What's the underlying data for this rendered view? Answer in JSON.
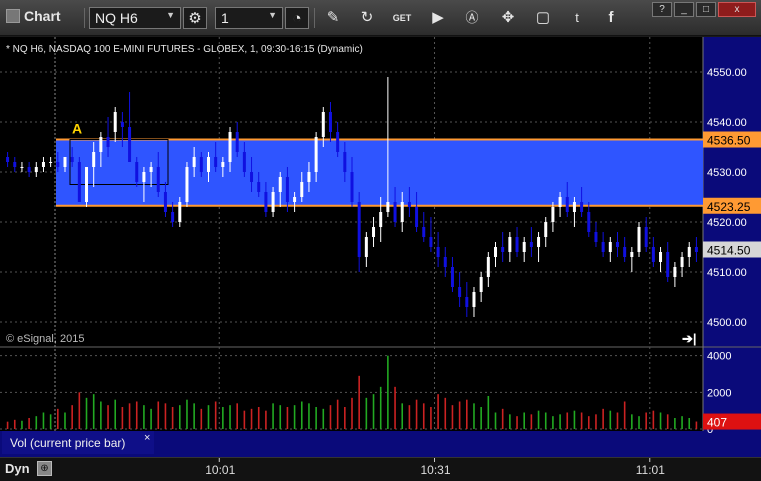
{
  "toolbar": {
    "title": "Chart",
    "symbol": "NQ H6",
    "interval": "1",
    "icons": [
      "link-icon",
      "clock-icon",
      "pencil-icon",
      "refresh-icon",
      "get-icon",
      "play-icon",
      "a-circle-icon",
      "tools-icon",
      "chat-icon",
      "twitter-icon",
      "facebook-icon"
    ],
    "window_buttons": [
      "?",
      "_",
      "□",
      "x"
    ]
  },
  "chart": {
    "header": "* NQ H6, NASDAQ 100 E-MINI FUTURES - GLOBEX, 1, 09:30-16:15 (Dynamic)",
    "watermark": "© eSignal, 2015",
    "annotation_label": "A",
    "range_high_label": "4536.50",
    "range_low_label": "4523.25",
    "current_price_label": "4514.50",
    "price_ticks": [
      "4550.00",
      "4540.00",
      "4530.00",
      "4520.00",
      "4510.00",
      "4500.00"
    ],
    "volume_ticks": [
      "4000",
      "2000",
      "0"
    ],
    "current_volume_label": "407",
    "time_ticks": [
      "10:01",
      "10:31",
      "11:01"
    ],
    "volume_panel_label": "Vol (current price bar)",
    "volume_close": "×",
    "colors": {
      "background": "#000000",
      "axis_bg": "#0a0a7a",
      "band_fill": "#2f55ff",
      "band_line": "#ff9a33",
      "up_bar": "#ffffff",
      "down_bar": "#1010e0",
      "vol_up": "#22aa22",
      "vol_down": "#cc2222",
      "vol_last": "#dd1111"
    }
  },
  "chart_data": {
    "type": "bar",
    "title": "",
    "price": {
      "ylim": [
        4496,
        4555
      ],
      "bars": [
        [
          4533,
          4534,
          4531,
          4532
        ],
        [
          4532,
          4533,
          4530,
          4531
        ],
        [
          4531,
          4532,
          4530,
          4531
        ],
        [
          4531,
          4532,
          4529,
          4530
        ],
        [
          4530,
          4532,
          4529,
          4531
        ],
        [
          4531,
          4533,
          4530,
          4532
        ],
        [
          4532,
          4533,
          4531,
          4532
        ],
        [
          4532,
          4534,
          4530,
          4531
        ],
        [
          4531,
          4533,
          4530,
          4533
        ],
        [
          4533,
          4535,
          4531,
          4532
        ],
        [
          4532,
          4533,
          4524,
          4524
        ],
        [
          4524,
          4531,
          4523,
          4531
        ],
        [
          4531,
          4536,
          4527,
          4534
        ],
        [
          4534,
          4538,
          4531,
          4537
        ],
        [
          4537,
          4541,
          4533,
          4535
        ],
        [
          4538,
          4543,
          4536,
          4542
        ],
        [
          4540,
          4542,
          4535,
          4539
        ],
        [
          4539,
          4546,
          4532,
          4532
        ],
        [
          4532,
          4533,
          4527,
          4528
        ],
        [
          4528,
          4531,
          4524,
          4530
        ],
        [
          4530,
          4532,
          4527,
          4531
        ],
        [
          4531,
          4534,
          4525,
          4526
        ],
        [
          4526,
          4528,
          4521,
          4522
        ],
        [
          4522,
          4524,
          4519,
          4520
        ],
        [
          4520,
          4525,
          4519,
          4524
        ],
        [
          4524,
          4532,
          4523,
          4531
        ],
        [
          4531,
          4535,
          4529,
          4533
        ],
        [
          4533,
          4534,
          4529,
          4530
        ],
        [
          4530,
          4534,
          4528,
          4533
        ],
        [
          4533,
          4536,
          4530,
          4531
        ],
        [
          4531,
          4533,
          4529,
          4532
        ],
        [
          4532,
          4539,
          4530,
          4538
        ],
        [
          4538,
          4540,
          4533,
          4534
        ],
        [
          4534,
          4536,
          4529,
          4530
        ],
        [
          4530,
          4533,
          4526,
          4528
        ],
        [
          4528,
          4530,
          4525,
          4526
        ],
        [
          4526,
          4528,
          4521,
          4522
        ],
        [
          4522,
          4527,
          4521,
          4526
        ],
        [
          4526,
          4530,
          4523,
          4529
        ],
        [
          4529,
          4531,
          4522,
          4524
        ],
        [
          4524,
          4526,
          4522,
          4525
        ],
        [
          4525,
          4530,
          4524,
          4528
        ],
        [
          4528,
          4532,
          4526,
          4530
        ],
        [
          4530,
          4538,
          4528,
          4537
        ],
        [
          4537,
          4543,
          4535,
          4542
        ],
        [
          4542,
          4544,
          4536,
          4538
        ],
        [
          4538,
          4540,
          4533,
          4534
        ],
        [
          4534,
          4536,
          4528,
          4530
        ],
        [
          4530,
          4533,
          4523,
          4524
        ],
        [
          4524,
          4526,
          4510,
          4513
        ],
        [
          4513,
          4518,
          4511,
          4517
        ],
        [
          4517,
          4521,
          4515,
          4519
        ],
        [
          4519,
          4525,
          4516,
          4522
        ],
        [
          4522,
          4549,
          4521,
          4524
        ],
        [
          4524,
          4527,
          4519,
          4520
        ],
        [
          4520,
          4526,
          4518,
          4524
        ],
        [
          4524,
          4527,
          4521,
          4523
        ],
        [
          4523,
          4526,
          4518,
          4519
        ],
        [
          4519,
          4522,
          4516,
          4517
        ],
        [
          4517,
          4521,
          4514,
          4515
        ],
        [
          4515,
          4518,
          4511,
          4513
        ],
        [
          4513,
          4515,
          4509,
          4511
        ],
        [
          4511,
          4513,
          4506,
          4507
        ],
        [
          4507,
          4510,
          4503,
          4505
        ],
        [
          4505,
          4508,
          4501,
          4503
        ],
        [
          4503,
          4507,
          4501,
          4506
        ],
        [
          4506,
          4510,
          4504,
          4509
        ],
        [
          4509,
          4514,
          4507,
          4513
        ],
        [
          4513,
          4516,
          4511,
          4515
        ],
        [
          4515,
          4518,
          4512,
          4514
        ],
        [
          4514,
          4518,
          4512,
          4517
        ],
        [
          4517,
          4519,
          4513,
          4514
        ],
        [
          4514,
          4517,
          4512,
          4516
        ],
        [
          4516,
          4519,
          4513,
          4515
        ],
        [
          4515,
          4518,
          4512,
          4517
        ],
        [
          4517,
          4521,
          4515,
          4520
        ],
        [
          4520,
          4524,
          4518,
          4523
        ],
        [
          4523,
          4526,
          4521,
          4525
        ],
        [
          4525,
          4528,
          4521,
          4522
        ],
        [
          4522,
          4525,
          4519,
          4524
        ],
        [
          4524,
          4527,
          4521,
          4522
        ],
        [
          4522,
          4524,
          4517,
          4518
        ],
        [
          4518,
          4520,
          4515,
          4516
        ],
        [
          4516,
          4518,
          4513,
          4514
        ],
        [
          4514,
          4517,
          4512,
          4516
        ],
        [
          4516,
          4518,
          4513,
          4515
        ],
        [
          4515,
          4517,
          4512,
          4513
        ],
        [
          4513,
          4515,
          4510,
          4514
        ],
        [
          4514,
          4520,
          4513,
          4519
        ],
        [
          4519,
          4521,
          4514,
          4515
        ],
        [
          4515,
          4517,
          4511,
          4512
        ],
        [
          4512,
          4515,
          4510,
          4514
        ],
        [
          4514,
          4516,
          4508,
          4509
        ],
        [
          4509,
          4512,
          4507,
          4511
        ],
        [
          4511,
          4514,
          4509,
          4513
        ],
        [
          4513,
          4516,
          4511,
          4515
        ],
        [
          4515,
          4517,
          4512,
          4514
        ]
      ],
      "range_band": [
        4523.25,
        4536.5
      ],
      "current": 4514.5
    },
    "volume": {
      "ylim": [
        0,
        4200
      ],
      "values": [
        400,
        500,
        450,
        600,
        700,
        900,
        800,
        1100,
        900,
        1300,
        2000,
        1700,
        1900,
        1500,
        1300,
        1600,
        1200,
        1400,
        1500,
        1300,
        1100,
        1500,
        1400,
        1200,
        1300,
        1600,
        1400,
        1100,
        1300,
        1500,
        1200,
        1300,
        1400,
        1000,
        1100,
        1200,
        1000,
        1400,
        1300,
        1200,
        1300,
        1500,
        1400,
        1200,
        1100,
        1300,
        1600,
        1200,
        1700,
        2900,
        1700,
        1900,
        2300,
        4000,
        2300,
        1400,
        1300,
        1600,
        1400,
        1200,
        1900,
        1700,
        1300,
        1500,
        1600,
        1400,
        1200,
        1800,
        900,
        1100,
        800,
        700,
        900,
        800,
        1000,
        900,
        700,
        800,
        900,
        1000,
        900,
        700,
        800,
        1100,
        1000,
        900,
        1500,
        800,
        700,
        900,
        1000,
        900,
        800,
        600,
        700,
        600,
        407
      ],
      "current": 407
    }
  }
}
